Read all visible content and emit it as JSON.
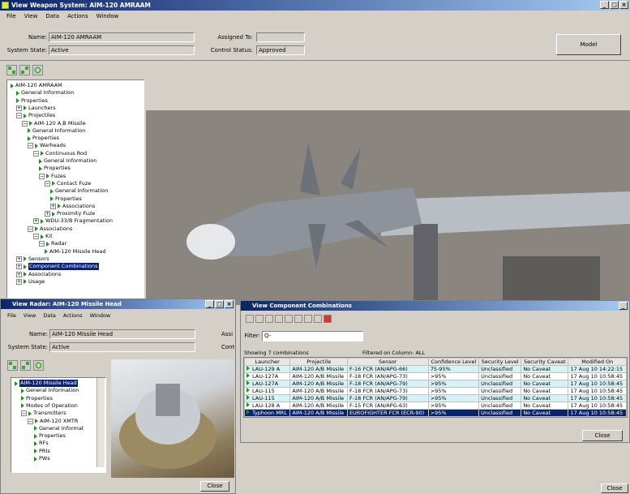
{
  "main": {
    "title": "View Weapon System: AIM-120 AMRAAM",
    "menu": [
      "File",
      "View",
      "Data",
      "Actions",
      "Window"
    ],
    "name_label": "Name:",
    "name_value": "AIM-120 AMRAAM",
    "state_label": "System State:",
    "state_value": "Active",
    "assigned_label": "Assigned To:",
    "assigned_value": "",
    "control_label": "Control Status:",
    "control_value": "Approved",
    "model_button": "Model",
    "tree": [
      {
        "label": "AIM-120 AMRAAM",
        "indent": 0,
        "type": "root"
      },
      {
        "label": "General Information",
        "indent": 1,
        "type": "leaf"
      },
      {
        "label": "Properties",
        "indent": 1,
        "type": "leaf"
      },
      {
        "label": "Launchers",
        "indent": 1,
        "type": "plus"
      },
      {
        "label": "Projectiles",
        "indent": 1,
        "type": "minus"
      },
      {
        "label": "AIM-120 A,B Missile",
        "indent": 2,
        "type": "minus"
      },
      {
        "label": "General Information",
        "indent": 3,
        "type": "leaf"
      },
      {
        "label": "Properties",
        "indent": 3,
        "type": "leaf"
      },
      {
        "label": "Warheads",
        "indent": 3,
        "type": "minus"
      },
      {
        "label": "Continuous Rod",
        "indent": 4,
        "type": "minus"
      },
      {
        "label": "General Information",
        "indent": 5,
        "type": "leaf"
      },
      {
        "label": "Properties",
        "indent": 5,
        "type": "leaf"
      },
      {
        "label": "Fuzes",
        "indent": 5,
        "type": "minus"
      },
      {
        "label": "Contact Fuze",
        "indent": 6,
        "type": "minus"
      },
      {
        "label": "General Information",
        "indent": 7,
        "type": "leaf"
      },
      {
        "label": "Properties",
        "indent": 7,
        "type": "leaf"
      },
      {
        "label": "Associations",
        "indent": 7,
        "type": "plus"
      },
      {
        "label": "Proximity Fuze",
        "indent": 6,
        "type": "plus"
      },
      {
        "label": "WDU-33/B Fragmentation",
        "indent": 4,
        "type": "plus"
      },
      {
        "label": "Associations",
        "indent": 3,
        "type": "minus"
      },
      {
        "label": "Kit",
        "indent": 4,
        "type": "minus"
      },
      {
        "label": "Radar",
        "indent": 5,
        "type": "minus"
      },
      {
        "label": "AIM-120 Missile Head",
        "indent": 6,
        "type": "leaf"
      },
      {
        "label": "Sensors",
        "indent": 1,
        "type": "plus"
      },
      {
        "label": "Component Combinations",
        "indent": 1,
        "type": "plus",
        "selected": true
      },
      {
        "label": "Associations",
        "indent": 1,
        "type": "plus"
      },
      {
        "label": "Usage",
        "indent": 1,
        "type": "plus"
      }
    ]
  },
  "radar": {
    "title": "View Radar: AIM-120 Missile Head",
    "menu": [
      "File",
      "View",
      "Data",
      "Actions",
      "Window"
    ],
    "name_label": "Name:",
    "name_value": "AIM-120 Missile Head",
    "state_label": "System State:",
    "state_value": "Active",
    "assigned_label_cut": "Assi",
    "control_label_cut": "Cont",
    "tree": [
      {
        "label": "AIM-120 Missile Head",
        "indent": 0,
        "type": "root",
        "selected": true
      },
      {
        "label": "General Information",
        "indent": 1,
        "type": "leaf"
      },
      {
        "label": "Properties",
        "indent": 1,
        "type": "leaf"
      },
      {
        "label": "Modes of Operation",
        "indent": 1,
        "type": "leaf"
      },
      {
        "label": "Transmitters",
        "indent": 1,
        "type": "minus"
      },
      {
        "label": "AIM-120 XMTR",
        "indent": 2,
        "type": "minus"
      },
      {
        "label": "General Informat",
        "indent": 3,
        "type": "leaf"
      },
      {
        "label": "Properties",
        "indent": 3,
        "type": "leaf"
      },
      {
        "label": "RFs",
        "indent": 3,
        "type": "leaf"
      },
      {
        "label": "PRIs",
        "indent": 3,
        "type": "leaf"
      },
      {
        "label": "PWs",
        "indent": 3,
        "type": "leaf"
      }
    ],
    "close": "Close"
  },
  "combos": {
    "title": "View Component Combinations",
    "filter_label": "Filter:",
    "filter_value": "Q-",
    "showing": "Showing 7 combinations",
    "filtered": "Filtered on Column: ALL",
    "columns": [
      "Launcher",
      "Projectile",
      "Sensor",
      "Confidence Level",
      "Security Level",
      "Security Caveat",
      "Modified On"
    ],
    "rows": [
      [
        "LAU-129 A",
        "AIM-120 A/B Missile",
        "F-16 FCR (AN/APG-66)",
        "75-95%",
        "Unclassified",
        "No Caveat",
        "17 Aug 10 14:22:15"
      ],
      [
        "LAU-127A",
        "AIM-120 A/B Missile",
        "F-18 FCR (AN/APG-73)",
        ">95%",
        "Unclassified",
        "No Caveat",
        "17 Aug 10 10:58:45"
      ],
      [
        "LAU-127A",
        "AIM-120 A/B Missile",
        "F-18 FCR (AN/APG-79)",
        ">95%",
        "Unclassified",
        "No Caveat",
        "17 Aug 10 10:58:45"
      ],
      [
        "LAU-115",
        "AIM-120 A/B Missile",
        "F-18 FCR (AN/APG-73)",
        ">95%",
        "Unclassified",
        "No Caveat",
        "17 Aug 10 10:58:45"
      ],
      [
        "LAU-115",
        "AIM-120 A/B Missile",
        "F-18 FCR (AN/APG-79)",
        ">95%",
        "Unclassified",
        "No Caveat",
        "17 Aug 10 10:58:45"
      ],
      [
        "LAU-128 A",
        "AIM-120 A/B Missile",
        "F-15 FCR (AN/APG-63)",
        ">95%",
        "Unclassified",
        "No Caveat",
        "17 Aug 10 10:58:45"
      ],
      [
        "Typhoon MRL",
        "AIM-120 A/B Missile",
        "EUROFIGHTER FCR (ECR-90)",
        ">95%",
        "Unclassified",
        "No Caveat",
        "17 Aug 10 10:58:45"
      ]
    ],
    "close": "Close"
  },
  "bottom_close": "Close"
}
